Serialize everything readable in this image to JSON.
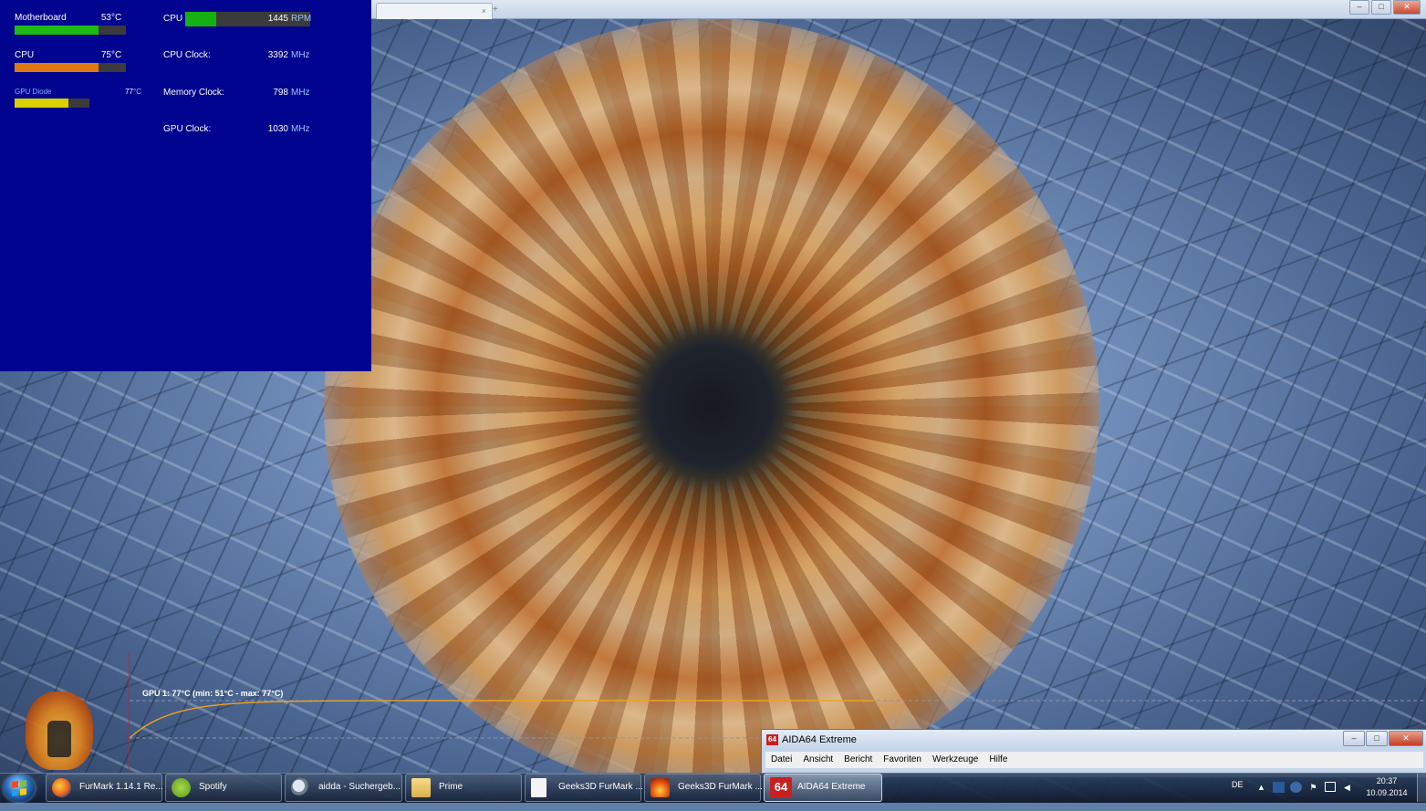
{
  "osd": {
    "temps": [
      {
        "label": "Motherboard",
        "value": "53",
        "unit": "°C",
        "level": 0.75,
        "color": "#1dbb12"
      },
      {
        "label": "CPU",
        "value": "75",
        "unit": "°C",
        "level": 0.75,
        "color": "#e07a10"
      },
      {
        "label": "GPU Diode",
        "value": "77",
        "unit": "°C",
        "level": 0.72,
        "color": "#d8d000"
      }
    ],
    "cpu_fan": {
      "label": "CPU",
      "value": "1445",
      "unit": "RPM",
      "level": 0.25,
      "color": "#17b012"
    },
    "clocks": [
      {
        "label": "CPU Clock:",
        "value": "3392",
        "unit": "MHz"
      },
      {
        "label": "Memory Clock:",
        "value": "798",
        "unit": "MHz"
      },
      {
        "label": "GPU Clock:",
        "value": "1030",
        "unit": "MHz"
      }
    ],
    "background_color": "#00048f"
  },
  "furmark": {
    "graph_label": "GPU 1: 77°C (min: 51°C - max: 77°C)",
    "gpu_temp_min": 51,
    "gpu_temp_max": 77,
    "line_color": "#f0a020"
  },
  "aida_window": {
    "icon_text": "64",
    "title": "AIDA64 Extreme",
    "menu": [
      "Datei",
      "Ansicht",
      "Bericht",
      "Favoriten",
      "Werkzeuge",
      "Hilfe"
    ]
  },
  "taskbar": {
    "items": [
      {
        "label": "FurMark 1.14.1 Re...",
        "icon": "firefox-icon",
        "active": false
      },
      {
        "label": "Spotify",
        "icon": "spotify-icon",
        "active": false
      },
      {
        "label": "aidda - Suchergeb...",
        "icon": "search-icon",
        "active": false
      },
      {
        "label": "Prime",
        "icon": "folder-icon",
        "active": false
      },
      {
        "label": "Geeks3D FurMark ...",
        "icon": "document-icon",
        "active": false
      },
      {
        "label": "Geeks3D FurMark ...",
        "icon": "furmark-icon",
        "active": false
      },
      {
        "label": "AIDA64 Extreme",
        "icon": "aida64-icon",
        "active": true
      }
    ],
    "language": "DE",
    "time": "20:37",
    "date": "10.09.2014"
  }
}
